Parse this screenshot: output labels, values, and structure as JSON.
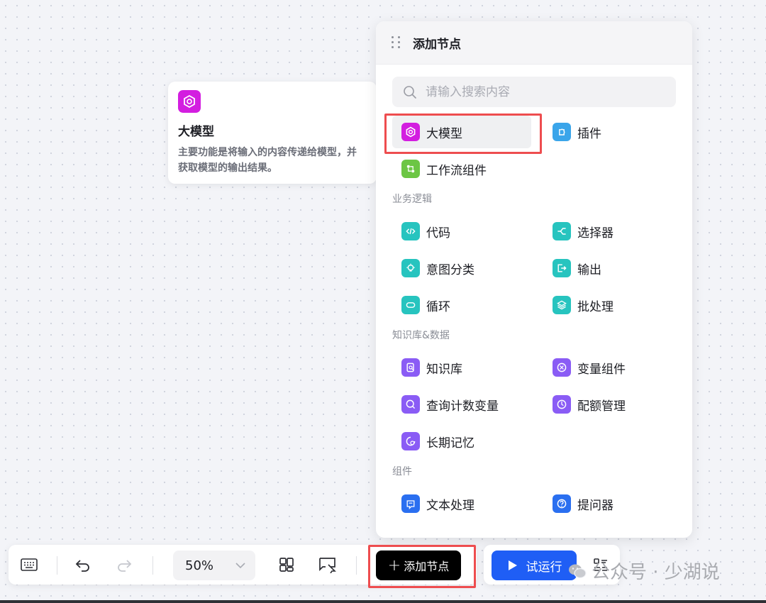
{
  "tooltip": {
    "title": "大模型",
    "description": "主要功能是将输入的内容传递给模型，并获取模型的输出结果。"
  },
  "panel": {
    "title": "添加节点",
    "search_placeholder": "请输入搜索内容",
    "top_nodes": [
      {
        "label": "大模型",
        "icon": "llm-icon",
        "color": "#d31ee0"
      },
      {
        "label": "插件",
        "icon": "plugin-icon",
        "color": "#3aa5ea"
      },
      {
        "label": "工作流组件",
        "icon": "workflow-icon",
        "color": "#6cc644"
      }
    ],
    "sections": [
      {
        "title": "业务逻辑",
        "items": [
          {
            "label": "代码",
            "icon": "code-icon",
            "color": "#27c4bf"
          },
          {
            "label": "选择器",
            "icon": "selector-icon",
            "color": "#27c4bf"
          },
          {
            "label": "意图分类",
            "icon": "intent-icon",
            "color": "#27c4bf"
          },
          {
            "label": "输出",
            "icon": "output-icon",
            "color": "#27c4bf"
          },
          {
            "label": "循环",
            "icon": "loop-icon",
            "color": "#27c4bf"
          },
          {
            "label": "批处理",
            "icon": "batch-icon",
            "color": "#27c4bf"
          }
        ]
      },
      {
        "title": "知识库&数据",
        "items": [
          {
            "label": "知识库",
            "icon": "knowledge-base-icon",
            "color": "#8a5cf5"
          },
          {
            "label": "变量组件",
            "icon": "variable-icon",
            "color": "#8a5cf5"
          },
          {
            "label": "查询计数变量",
            "icon": "query-count-icon",
            "color": "#8a5cf5"
          },
          {
            "label": "配额管理",
            "icon": "quota-icon",
            "color": "#8a5cf5"
          },
          {
            "label": "长期记忆",
            "icon": "memory-icon",
            "color": "#8a5cf5"
          }
        ]
      },
      {
        "title": "组件",
        "items": [
          {
            "label": "文本处理",
            "icon": "text-process-icon",
            "color": "#2a6ff0"
          },
          {
            "label": "提问器",
            "icon": "question-icon",
            "color": "#2a6ff0"
          }
        ]
      }
    ]
  },
  "toolbar": {
    "zoom": "50%",
    "add_node_label": "添加节点",
    "run_label": "试运行"
  },
  "watermark": {
    "text": "公众号 · 少湖说"
  }
}
